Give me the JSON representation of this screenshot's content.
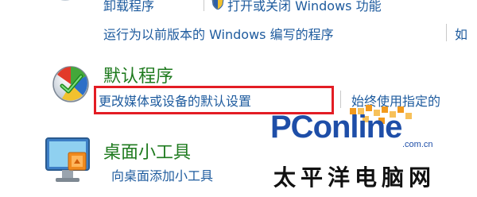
{
  "top": {
    "uninstall_link": "卸载程序",
    "toggle_features_link": "打开或关闭 Windows 功能"
  },
  "compat_link": "运行为以前版本的 Windows 编写的程序",
  "compat_next_link": "如",
  "default_programs": {
    "title": "默认程序",
    "change_media_link": "更改媒体或设备的默认设置",
    "always_use_link": "始终使用指定的"
  },
  "desktop_gadgets": {
    "title": "桌面小工具",
    "add_gadget_link": "向桌面添加小工具"
  },
  "watermark": {
    "brand": "PConline",
    "domain": ".com.cn",
    "chinese": "太平洋电脑网"
  },
  "colors": {
    "link": "#1e5b9e",
    "heading": "#1e7a1e",
    "highlight_box": "#e31d24",
    "brand": "#1e4ea8"
  }
}
